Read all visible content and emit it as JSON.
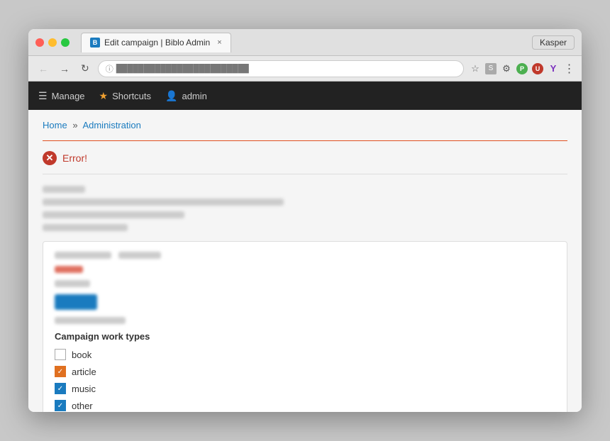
{
  "browser": {
    "tab_title": "Edit campaign | Biblo Admin",
    "tab_close": "×",
    "url": "",
    "kasper_label": "Kasper"
  },
  "navbar": {
    "manage_label": "Manage",
    "shortcuts_label": "Shortcuts",
    "admin_label": "admin"
  },
  "breadcrumb": {
    "home": "Home",
    "separator": "»",
    "current": "Administration"
  },
  "error": {
    "label": "Error!"
  },
  "campaign_section": {
    "work_types_label": "Campaign work types",
    "checkboxes": [
      {
        "label": "book",
        "state": "unchecked"
      },
      {
        "label": "article",
        "state": "checked-orange"
      },
      {
        "label": "music",
        "state": "checked-blue"
      },
      {
        "label": "other",
        "state": "checked-blue"
      }
    ]
  }
}
